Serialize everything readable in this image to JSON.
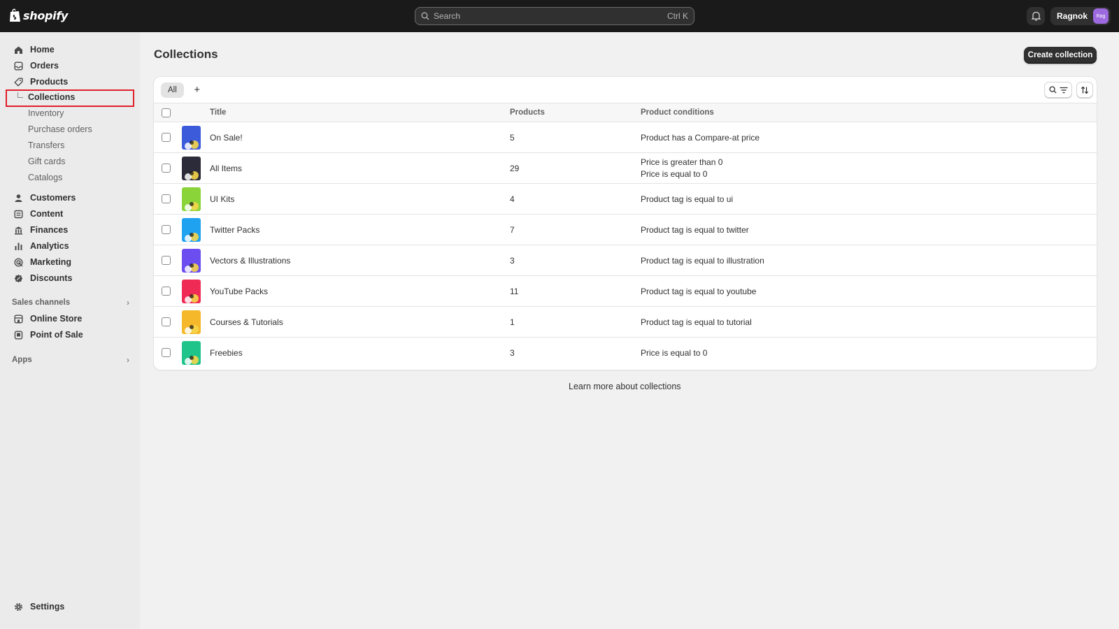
{
  "brand": {
    "name": "shopify"
  },
  "search": {
    "placeholder": "Search",
    "shortcut": "Ctrl K"
  },
  "user": {
    "name": "Ragnok",
    "initials": "Rag"
  },
  "sidebar": {
    "main_items": [
      {
        "label": "Home",
        "icon": "home-icon"
      },
      {
        "label": "Orders",
        "icon": "inbox-icon"
      },
      {
        "label": "Products",
        "icon": "tag-icon"
      }
    ],
    "product_sub_items": [
      "Collections",
      "Inventory",
      "Purchase orders",
      "Transfers",
      "Gift cards",
      "Catalogs"
    ],
    "secondary_items": [
      {
        "label": "Customers",
        "icon": "person-icon"
      },
      {
        "label": "Content",
        "icon": "content-icon"
      },
      {
        "label": "Finances",
        "icon": "bank-icon"
      },
      {
        "label": "Analytics",
        "icon": "bar-chart-icon"
      },
      {
        "label": "Marketing",
        "icon": "target-icon"
      },
      {
        "label": "Discounts",
        "icon": "discount-icon"
      }
    ],
    "sales_channels_label": "Sales channels",
    "channels": [
      {
        "label": "Online Store",
        "icon": "store-icon"
      },
      {
        "label": "Point of Sale",
        "icon": "pos-icon"
      }
    ],
    "apps_label": "Apps",
    "settings_label": "Settings"
  },
  "page": {
    "title": "Collections",
    "create_button": "Create collection",
    "tab_all": "All",
    "tab_add": "+",
    "columns": {
      "title": "Title",
      "products": "Products",
      "conditions": "Product conditions"
    },
    "rows": [
      {
        "title": "On Sale!",
        "products": "5",
        "conditions": [
          "Product has a Compare-at price"
        ],
        "color": "#3b5bdb"
      },
      {
        "title": "All Items",
        "products": "29",
        "conditions": [
          "Price is greater than 0",
          "Price is equal to 0"
        ],
        "color": "#2b2b3a"
      },
      {
        "title": "UI Kits",
        "products": "4",
        "conditions": [
          "Product tag is equal to ui"
        ],
        "color": "#8ad43a"
      },
      {
        "title": "Twitter Packs",
        "products": "7",
        "conditions": [
          "Product tag is equal to twitter"
        ],
        "color": "#1fa2f0"
      },
      {
        "title": "Vectors & Illustrations",
        "products": "3",
        "conditions": [
          "Product tag is equal to illustration"
        ],
        "color": "#6c4df0"
      },
      {
        "title": "YouTube Packs",
        "products": "11",
        "conditions": [
          "Product tag is equal to youtube"
        ],
        "color": "#ef2b55"
      },
      {
        "title": "Courses & Tutorials",
        "products": "1",
        "conditions": [
          "Product tag is equal to tutorial"
        ],
        "color": "#f5b82a"
      },
      {
        "title": "Freebies",
        "products": "3",
        "conditions": [
          "Price is equal to 0"
        ],
        "color": "#1fc48a"
      }
    ],
    "learn_more_prefix": "Learn more about ",
    "learn_more_link": "collections"
  },
  "colors": {
    "topbar": "#1a1a1a",
    "sidebar": "#ebebeb",
    "background": "#f1f1f1",
    "primary_button": "#303030",
    "link": "#005bd3",
    "highlight": "#e0202a"
  }
}
